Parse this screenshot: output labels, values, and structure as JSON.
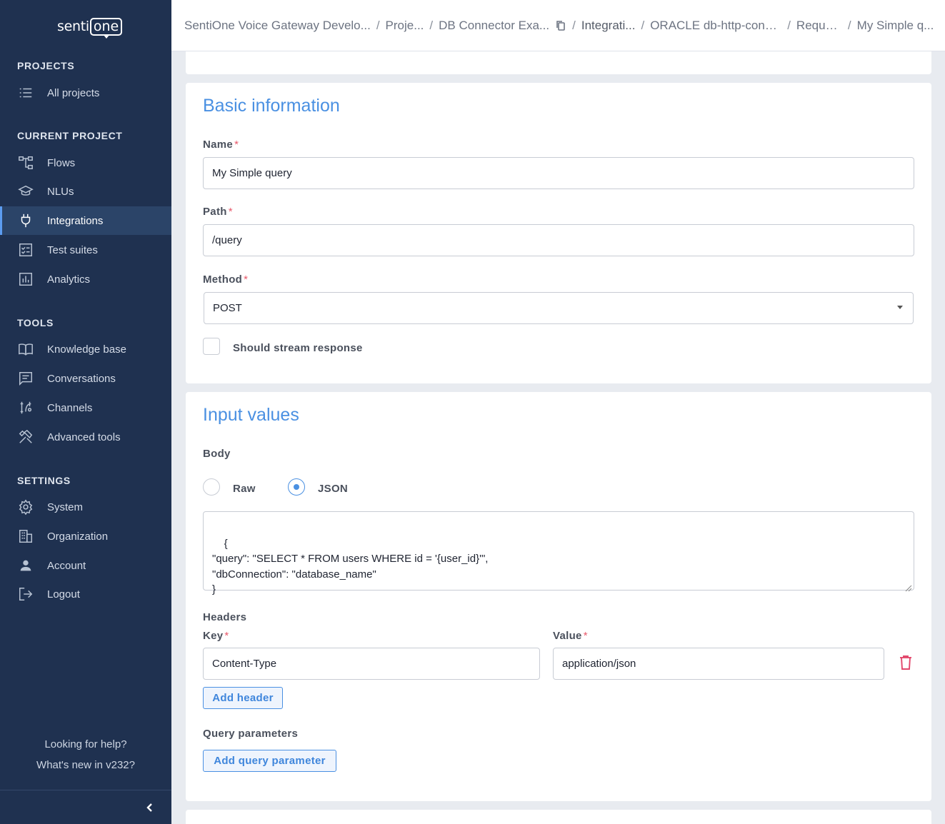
{
  "logo": {
    "part1": "senti",
    "part2": "one"
  },
  "sidebar": {
    "sections": {
      "projects": "PROJECTS",
      "current_project": "CURRENT PROJECT",
      "tools": "TOOLS",
      "settings": "SETTINGS"
    },
    "items": [
      {
        "label": "All projects",
        "icon": "list-icon"
      },
      {
        "label": "Flows",
        "icon": "flows-icon"
      },
      {
        "label": "NLUs",
        "icon": "graduation-cap-icon"
      },
      {
        "label": "Integrations",
        "icon": "plug-icon",
        "active": true
      },
      {
        "label": "Test suites",
        "icon": "checklist-icon"
      },
      {
        "label": "Analytics",
        "icon": "bar-chart-icon"
      },
      {
        "label": "Knowledge base",
        "icon": "book-icon"
      },
      {
        "label": "Conversations",
        "icon": "message-icon"
      },
      {
        "label": "Channels",
        "icon": "channels-icon"
      },
      {
        "label": "Advanced tools",
        "icon": "tools-icon"
      },
      {
        "label": "System",
        "icon": "gear-icon"
      },
      {
        "label": "Organization",
        "icon": "building-icon"
      },
      {
        "label": "Account",
        "icon": "person-icon"
      },
      {
        "label": "Logout",
        "icon": "logout-icon"
      }
    ],
    "help": "Looking for help?",
    "whats_new": "What's new in v232?"
  },
  "breadcrumb": [
    "SentiOne Voice Gateway Develo...",
    "Proje...",
    "DB Connector Exa...",
    "Integrati...",
    "ORACLE db-http-conn...",
    "Reque...",
    "My Simple q..."
  ],
  "basic": {
    "title": "Basic information",
    "name_label": "Name",
    "name_value": "My Simple query",
    "path_label": "Path",
    "path_value": "/query",
    "method_label": "Method",
    "method_value": "POST",
    "stream_label": "Should stream response",
    "stream_checked": false
  },
  "input_values": {
    "title": "Input values",
    "body_label": "Body",
    "raw_label": "Raw",
    "json_label": "JSON",
    "selected": "JSON",
    "body_text": "{\n\"query\": \"SELECT * FROM users WHERE id = '{user_id}'\",\n\"dbConnection\": \"database_name\"\n}",
    "headers_label": "Headers",
    "key_label": "Key",
    "value_label": "Value",
    "header_key": "Content-Type",
    "header_value": "application/json",
    "add_header": "Add header",
    "query_params_label": "Query parameters",
    "add_query_param": "Add query parameter"
  },
  "colors": {
    "sidebar_bg": "#1f3150",
    "accent": "#4a90e2",
    "required": "#e8596b",
    "delete": "#e2476b"
  }
}
